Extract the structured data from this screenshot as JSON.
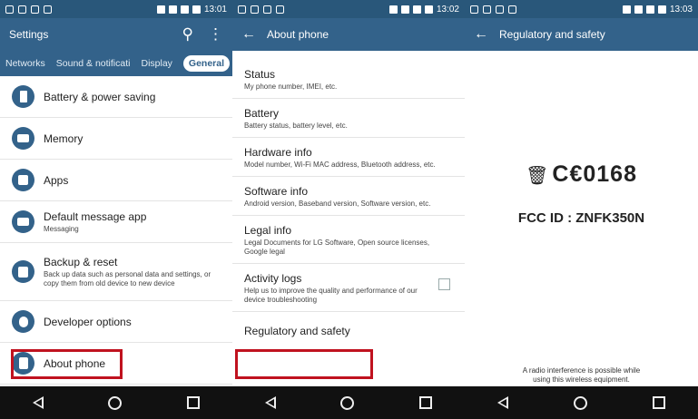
{
  "status_bar": {
    "time_1": "13:01",
    "time_2": "13:02",
    "time_3": "13:03"
  },
  "screen1": {
    "title": "Settings",
    "tabs": [
      "Networks",
      "Sound & notificati",
      "Display",
      "General"
    ],
    "items": [
      {
        "label": "Battery & power saving",
        "icon": "battery-icon"
      },
      {
        "label": "Memory",
        "icon": "memory-icon"
      },
      {
        "label": "Apps",
        "icon": "apps-icon"
      },
      {
        "label": "Default message app",
        "sub": "Messaging",
        "icon": "message-icon"
      },
      {
        "label": "Backup & reset",
        "sub": "Back up data such as personal data and settings, or copy them from old device to new device",
        "icon": "backup-icon"
      },
      {
        "label": "Developer options",
        "icon": "developer-icon"
      },
      {
        "label": "About phone",
        "icon": "about-icon"
      }
    ]
  },
  "screen2": {
    "title": "About phone",
    "items": [
      {
        "label": "Status",
        "sub": "My phone number, IMEI, etc."
      },
      {
        "label": "Battery",
        "sub": "Battery status, battery level, etc."
      },
      {
        "label": "Hardware info",
        "sub": "Model number, Wi-Fi MAC address, Bluetooth address, etc."
      },
      {
        "label": "Software info",
        "sub": "Android version, Baseband version, Software version, etc."
      },
      {
        "label": "Legal info",
        "sub": "Legal Documents for LG Software, Open source licenses, Google legal"
      },
      {
        "label": "Activity logs",
        "sub": "Help us to improve the quality and performance of our device troubleshooting"
      },
      {
        "label": "Regulatory and safety"
      }
    ]
  },
  "screen3": {
    "title": "Regulatory and safety",
    "ce_mark": "C€0168",
    "fcc_id": "FCC ID : ZNFK350N",
    "note": "A radio interference is possible while using this wireless equipment."
  },
  "colors": {
    "header": "#33628a",
    "status": "#29577a",
    "highlight": "#c0121f"
  }
}
